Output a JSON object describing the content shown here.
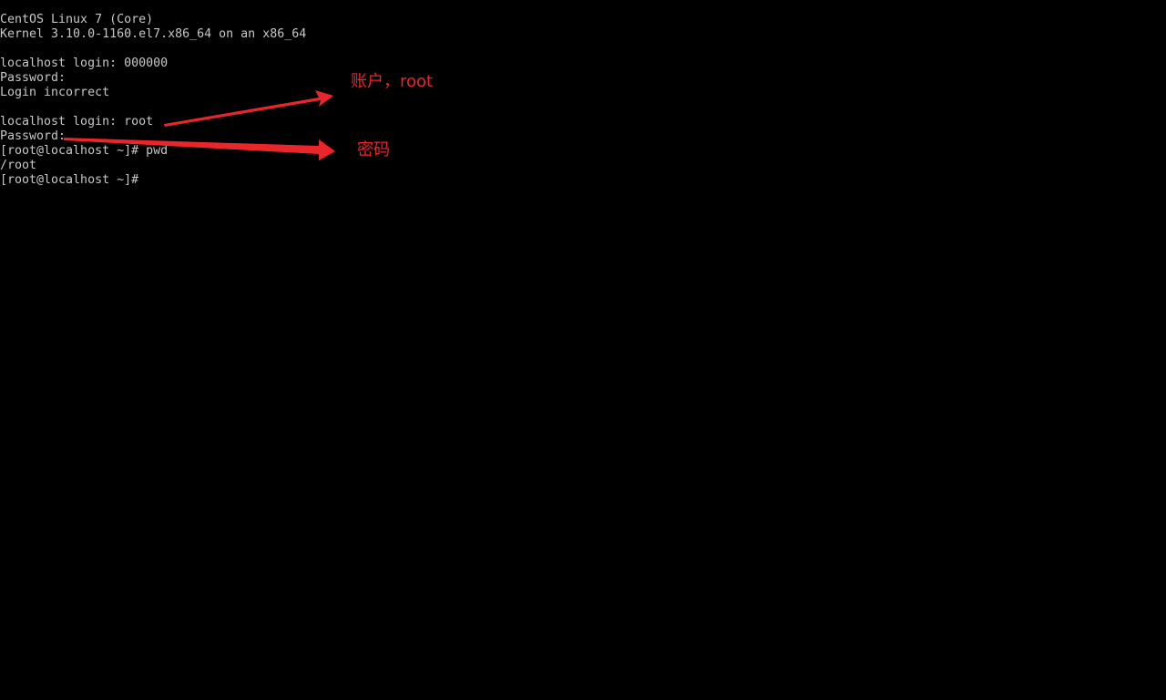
{
  "terminal": {
    "lines": [
      "CentOS Linux 7 (Core)",
      "Kernel 3.10.0-1160.el7.x86_64 on an x86_64",
      "",
      "localhost login: 000000",
      "Password:",
      "Login incorrect",
      "",
      "localhost login: root",
      "Password:",
      "[root@localhost ~]# pwd",
      "/root",
      "[root@localhost ~]#"
    ]
  },
  "annotations": {
    "account_label": "账户，root",
    "password_label": "密码"
  },
  "colors": {
    "background": "#000000",
    "terminal_text": "#c8c8c8",
    "annotation": "#e8262b"
  }
}
